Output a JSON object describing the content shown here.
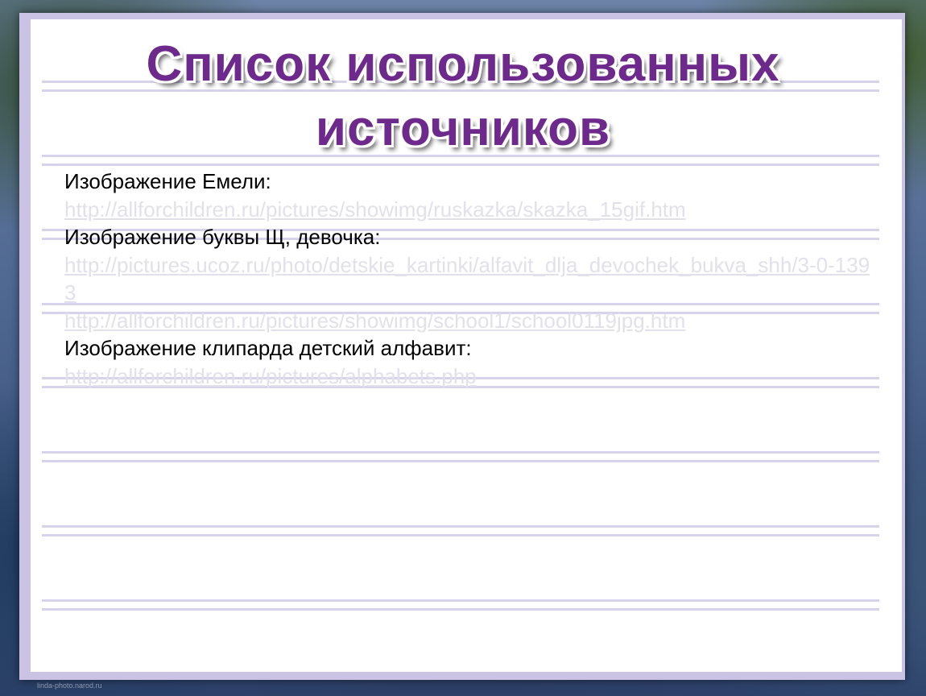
{
  "slide": {
    "title_line1": "Список использованных",
    "title_line2": "источников",
    "entries": [
      {
        "label": "Изображение  Емели:",
        "link": "http://allforchildren.ru/pictures/showimg/ruskazka/skazka_15gif.htm"
      },
      {
        "label": "Изображение буквы Щ, девочка:",
        "link": "http://pictures.ucoz.ru/photo/detskie_kartinki/alfavit_dlja_devochek_bukva_shh/3-0-1393",
        "link2": "http://allforchildren.ru/pictures/showimg/school1/school0119jpg.htm"
      },
      {
        "label": "Изображение  клипарда детский алфавит:",
        "link": "http://allforchildren.ru/pictures/alphabets.php"
      }
    ],
    "watermark": "linda-photo.narod.ru"
  },
  "colors": {
    "title": "#6d2a8c",
    "title_outline": "#ffffff",
    "link": "#e2e0ea",
    "ruled_line": "#d8d3ec",
    "frame": "#cbc3e3"
  }
}
